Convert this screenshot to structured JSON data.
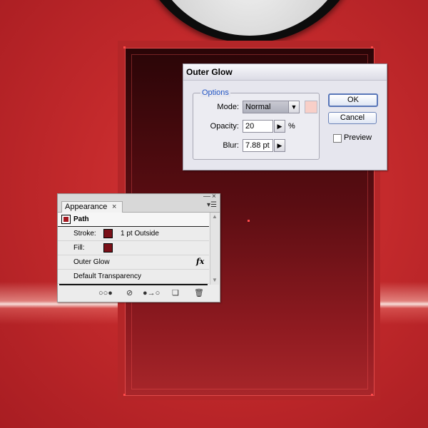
{
  "outer_glow_dialog": {
    "title": "Outer Glow",
    "options_legend": "Options",
    "mode_label": "Mode:",
    "mode_value": "Normal",
    "opacity_label": "Opacity:",
    "opacity_value": "20",
    "opacity_unit": "%",
    "blur_label": "Blur:",
    "blur_value": "7.88 pt",
    "ok_label": "OK",
    "cancel_label": "Cancel",
    "preview_label": "Preview",
    "preview_checked": false,
    "glow_color": "#f8cfc8"
  },
  "appearance_panel": {
    "tab_label": "Appearance",
    "tab_close": "×",
    "title": "Path",
    "rows": [
      {
        "label": "Stroke:",
        "value": "1 pt Outside",
        "swatch": "#7a1018"
      },
      {
        "label": "Fill:",
        "value": "",
        "swatch": "#7a1018"
      },
      {
        "label": "Outer Glow",
        "value": "",
        "fx": "fx"
      },
      {
        "label": "Default Transparency",
        "value": ""
      }
    ]
  },
  "colors": {
    "background_red": "#c42a2c",
    "card_dark": "#2a0507",
    "card_light": "#a8262a",
    "anchor_red": "#ff4a4a"
  }
}
